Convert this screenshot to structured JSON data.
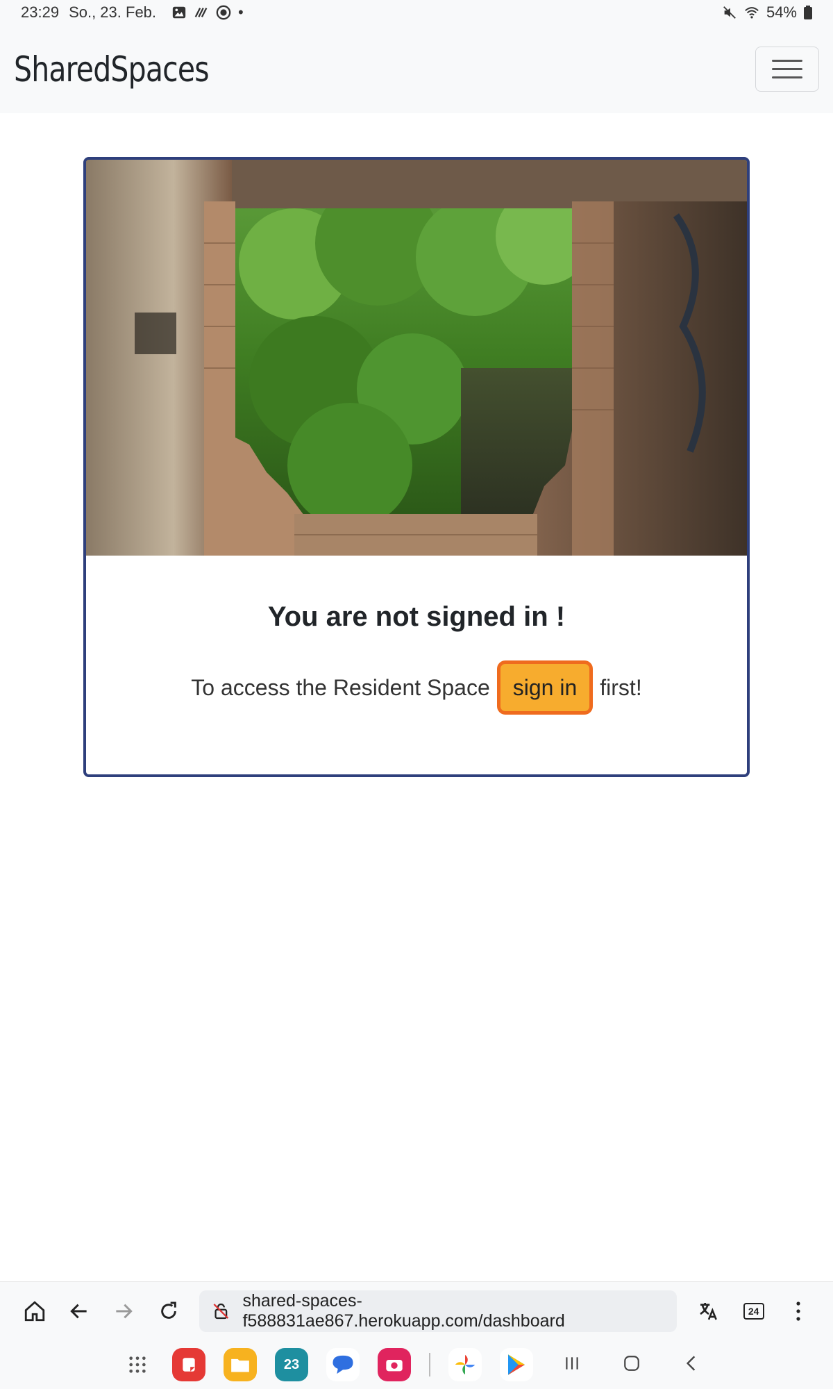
{
  "status_bar": {
    "time": "23:29",
    "date": "So., 23. Feb.",
    "battery": "54%"
  },
  "navbar": {
    "brand": "SharedSpaces"
  },
  "card": {
    "title": "You are not signed in !",
    "text_before": "To access the Resident Space",
    "button_label": "sign in",
    "text_after": "first!"
  },
  "browser": {
    "url": "shared-spaces-f588831ae867.herokuapp.com/dashboard",
    "tab_count": "24"
  },
  "dock": {
    "calendar_day": "23"
  },
  "colors": {
    "card_border": "#2e3f7c",
    "button_bg": "#f7ac2e",
    "button_border": "#ef6b1e"
  }
}
